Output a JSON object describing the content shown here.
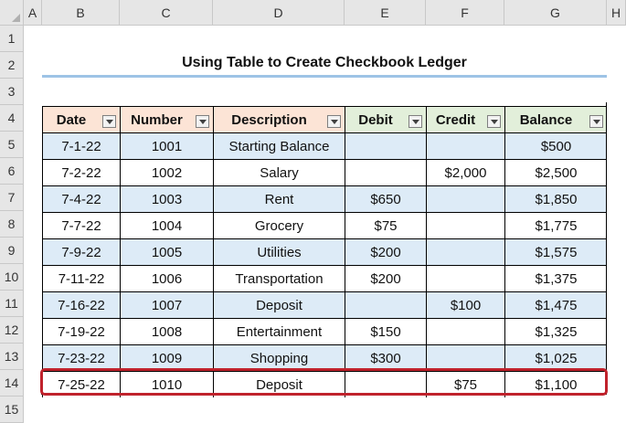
{
  "column_headers": [
    "A",
    "B",
    "C",
    "D",
    "E",
    "F",
    "G",
    "H"
  ],
  "row_headers": [
    "1",
    "2",
    "3",
    "4",
    "5",
    "6",
    "7",
    "8",
    "9",
    "10",
    "11",
    "12",
    "13",
    "14",
    "15"
  ],
  "title": "Using Table to Create Checkbook Ledger",
  "table": {
    "headers": [
      "Date",
      "Number",
      "Description",
      "Debit",
      "Credit",
      "Balance"
    ],
    "rows": [
      [
        "7-1-22",
        "1001",
        "Starting Balance",
        "",
        "",
        "$500"
      ],
      [
        "7-2-22",
        "1002",
        "Salary",
        "",
        "$2,000",
        "$2,500"
      ],
      [
        "7-4-22",
        "1003",
        "Rent",
        "$650",
        "",
        "$1,850"
      ],
      [
        "7-7-22",
        "1004",
        "Grocery",
        "$75",
        "",
        "$1,775"
      ],
      [
        "7-9-22",
        "1005",
        "Utilities",
        "$200",
        "",
        "$1,575"
      ],
      [
        "7-11-22",
        "1006",
        "Transportation",
        "$200",
        "",
        "$1,375"
      ],
      [
        "7-16-22",
        "1007",
        "Deposit",
        "",
        "$100",
        "$1,475"
      ],
      [
        "7-19-22",
        "1008",
        "Entertainment",
        "$150",
        "",
        "$1,325"
      ],
      [
        "7-23-22",
        "1009",
        "Shopping",
        "$300",
        "",
        "$1,025"
      ],
      [
        "7-25-22",
        "1010",
        "Deposit",
        "",
        "$75",
        "$1,100"
      ]
    ]
  },
  "colors": {
    "header_orange": "#fce4d6",
    "header_green": "#e2efda",
    "band_blue": "#ddebf7",
    "highlight_red": "#c0222c",
    "title_underline": "#9dc3e6"
  },
  "icons": {
    "filter": "filter-dropdown-icon"
  }
}
